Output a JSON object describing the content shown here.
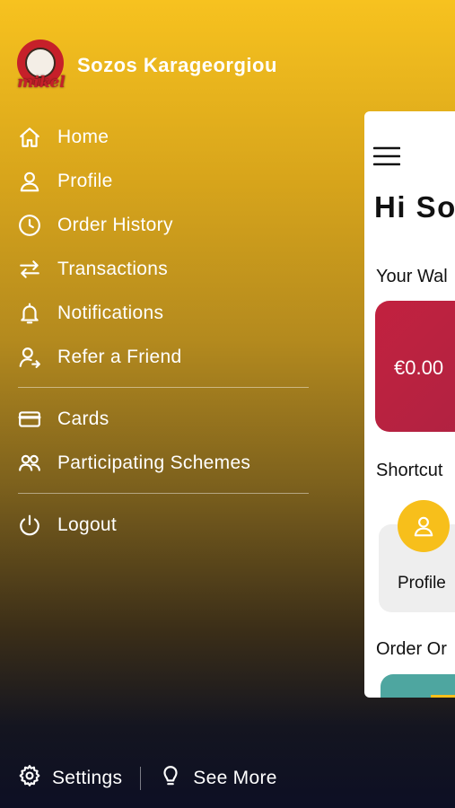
{
  "user": {
    "name": "Sozos Karageorgiou",
    "logo_text": "mikel",
    "logo_icon": "mikel-coffee-logo"
  },
  "menu": {
    "items": [
      {
        "label": "Home",
        "icon": "home-icon"
      },
      {
        "label": "Profile",
        "icon": "user-icon"
      },
      {
        "label": "Order History",
        "icon": "clock-icon"
      },
      {
        "label": "Transactions",
        "icon": "arrows-swap-icon"
      },
      {
        "label": "Notifications",
        "icon": "bell-icon"
      },
      {
        "label": "Refer a Friend",
        "icon": "refer-user-icon"
      }
    ],
    "items2": [
      {
        "label": "Cards",
        "icon": "credit-card-icon"
      },
      {
        "label": "Participating Schemes",
        "icon": "users-icon"
      }
    ],
    "logout": {
      "label": "Logout",
      "icon": "power-icon"
    }
  },
  "footer": {
    "settings": {
      "label": "Settings",
      "icon": "gear-icon"
    },
    "see_more": {
      "label": "See More",
      "icon": "lightbulb-icon"
    }
  },
  "preview": {
    "greeting": "Hi So",
    "wallet_label": "Your Wal",
    "wallet_amount": "€0.00",
    "shortcuts_label": "Shortcut",
    "shortcut_profile": "Profile",
    "order_label": "Order Or"
  },
  "colors": {
    "accent": "#f7bf1b",
    "wallet": "#c2213f",
    "order_card": "#4ea6a0"
  }
}
